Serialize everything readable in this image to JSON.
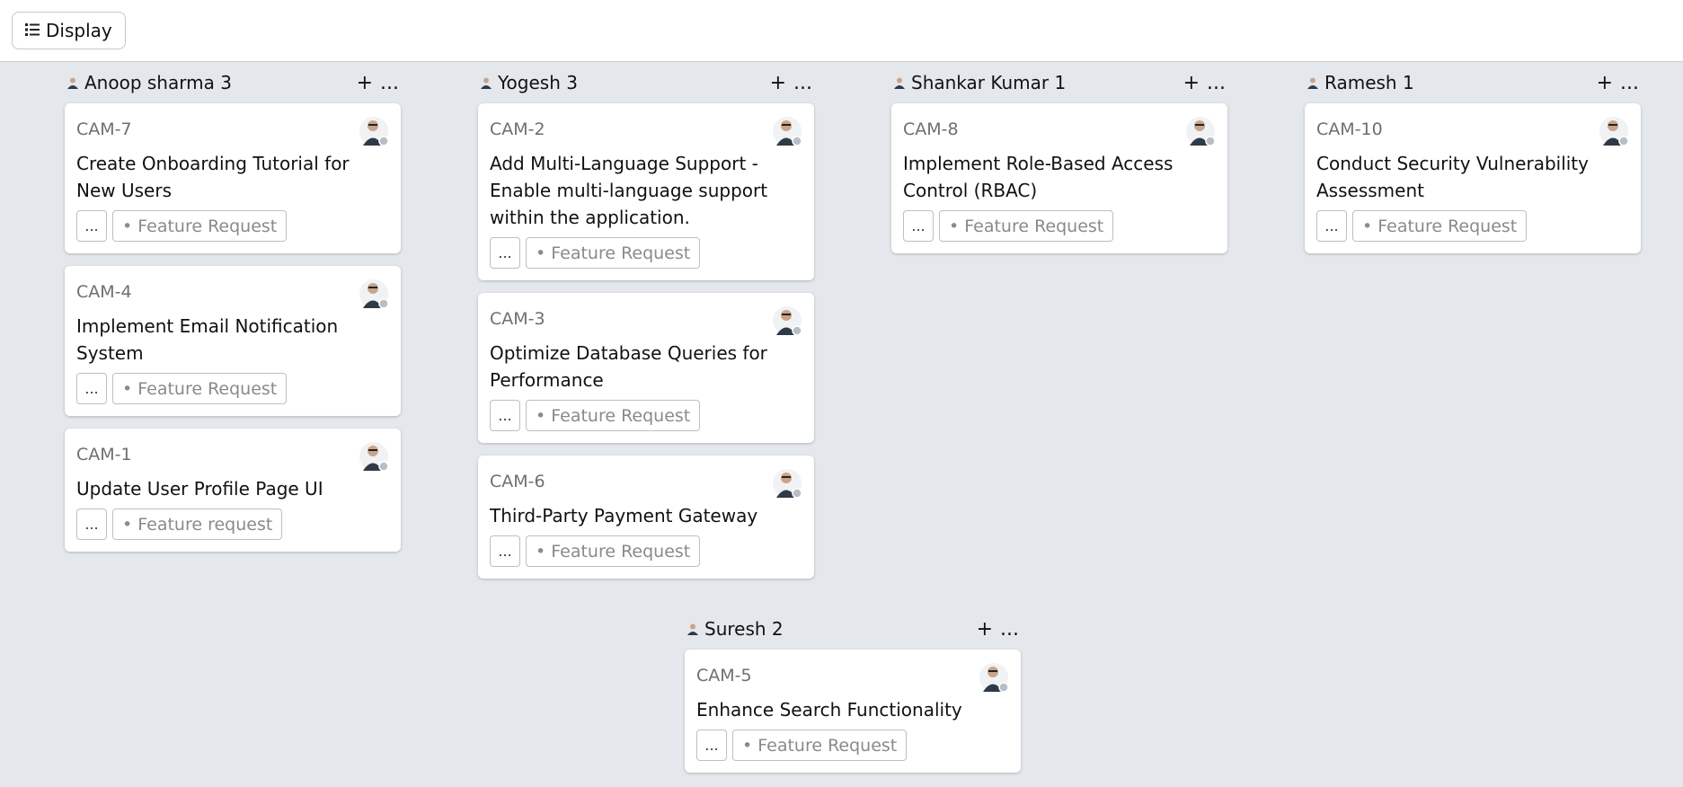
{
  "toolbar": {
    "display_icon": "list-icon",
    "display_label": "Display"
  },
  "columns": [
    {
      "title": "Anoop sharma 3",
      "add": "+",
      "more": "...",
      "cards": [
        {
          "id": "CAM-7",
          "title": "Create Onboarding Tutorial for New Users",
          "more": "...",
          "tag": "• Feature Request"
        },
        {
          "id": "CAM-4",
          "title": "Implement Email Notification System",
          "more": "...",
          "tag": "• Feature Request"
        },
        {
          "id": "CAM-1",
          "title": "Update User Profile Page UI",
          "more": "...",
          "tag": "• Feature request"
        }
      ]
    },
    {
      "title": "Yogesh 3",
      "add": "+",
      "more": "...",
      "cards": [
        {
          "id": "CAM-2",
          "title": "Add Multi-Language Support - Enable multi-language support within the application.",
          "more": "...",
          "tag": "• Feature Request"
        },
        {
          "id": "CAM-3",
          "title": "Optimize Database Queries for Performance",
          "more": "...",
          "tag": "• Feature Request"
        },
        {
          "id": "CAM-6",
          "title": "Third-Party Payment Gateway",
          "more": "...",
          "tag": "• Feature Request"
        }
      ]
    },
    {
      "title": "Shankar Kumar 1",
      "add": "+",
      "more": "...",
      "cards": [
        {
          "id": "CAM-8",
          "title": "Implement Role-Based Access Control (RBAC)",
          "more": "...",
          "tag": "• Feature Request"
        }
      ]
    },
    {
      "title": "Ramesh 1",
      "add": "+",
      "more": "...",
      "cards": [
        {
          "id": "CAM-10",
          "title": "Conduct Security Vulnerability Assessment",
          "more": "...",
          "tag": "• Feature Request"
        }
      ]
    },
    {
      "title": "Suresh 2",
      "add": "+",
      "more": "...",
      "cards": [
        {
          "id": "CAM-5",
          "title": "Enhance Search Functionality",
          "more": "...",
          "tag": "• Feature Request"
        }
      ]
    }
  ]
}
